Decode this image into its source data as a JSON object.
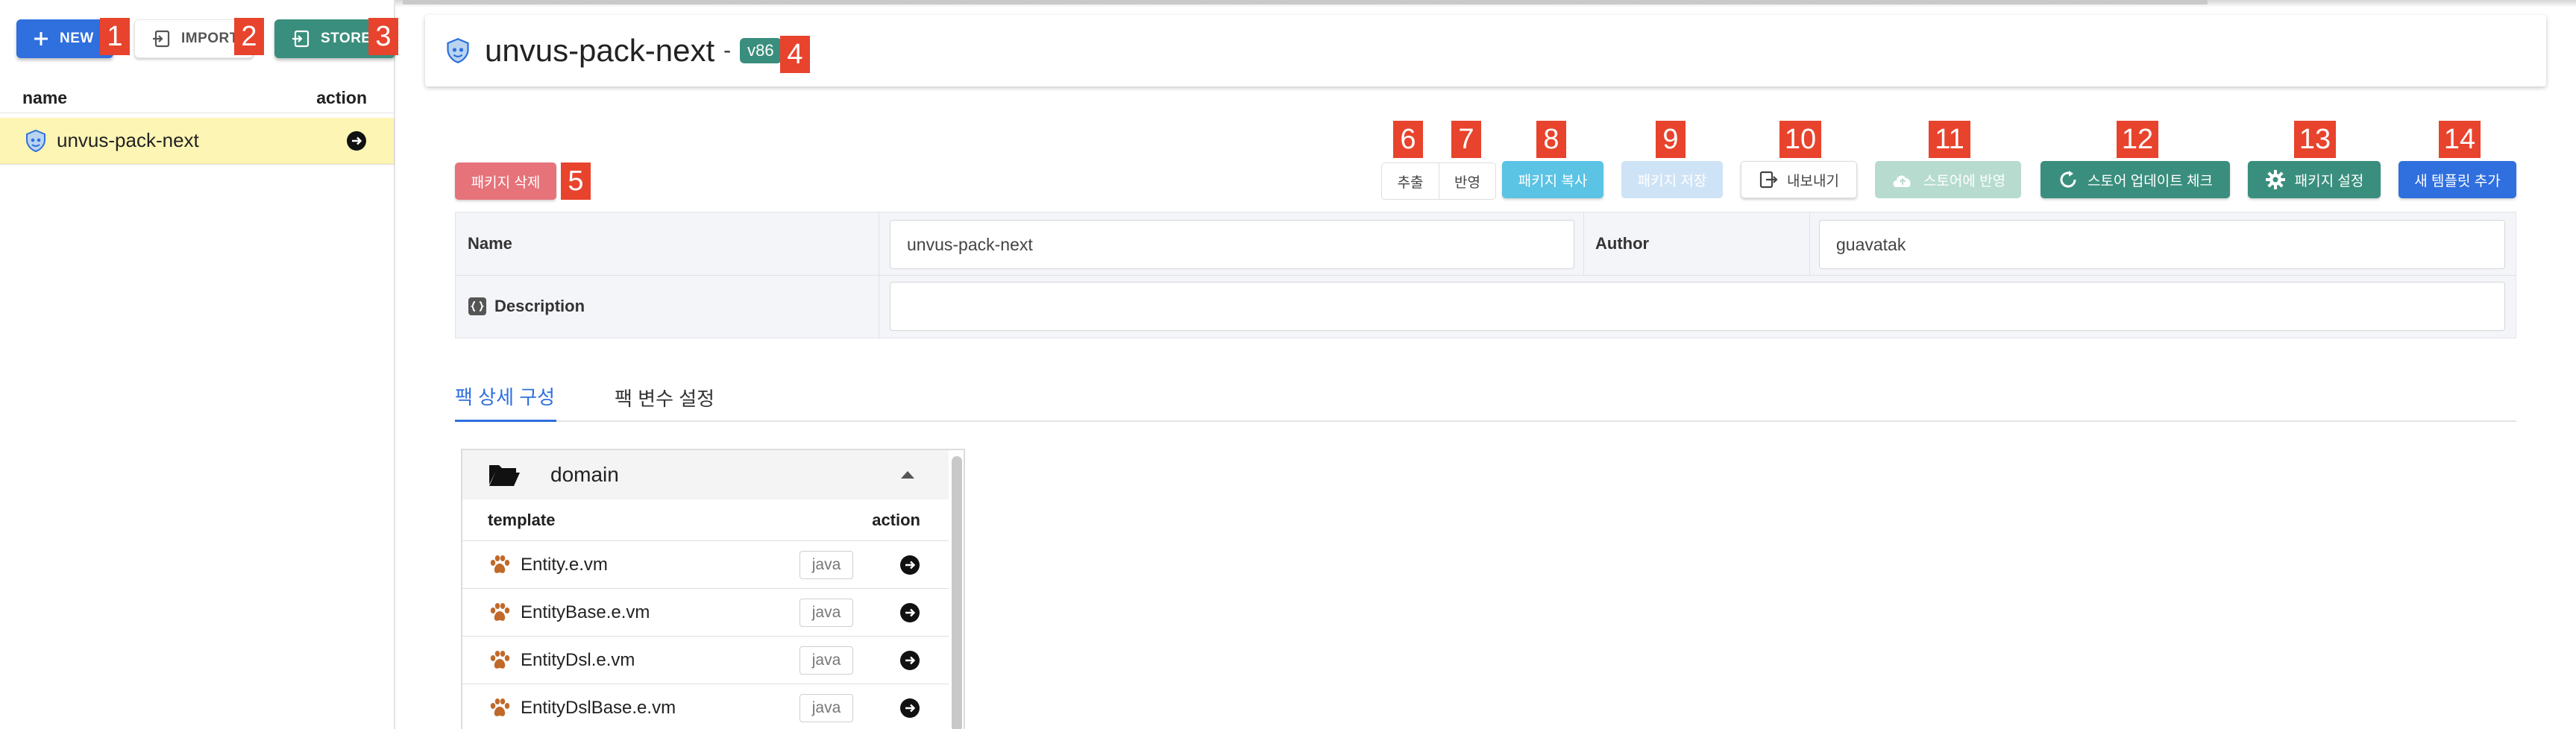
{
  "sidebar": {
    "new_label": "NEW",
    "import_label": "IMPORT",
    "store_label": "STORE",
    "col_name": "name",
    "col_action": "action",
    "items": [
      {
        "label": "unvus-pack-next"
      }
    ]
  },
  "header": {
    "title": "unvus-pack-next",
    "separator": "-",
    "version": "v86"
  },
  "actions": {
    "delete": "패키지 삭제",
    "extract": "추출",
    "apply": "반영",
    "copy": "패키지 복사",
    "save": "패키지 저장",
    "export": "내보내기",
    "store_apply": "스토어에 반영",
    "update_check": "스토어 업데이트 체크",
    "settings": "패키지 설정",
    "new_template": "새 템플릿 추가"
  },
  "info": {
    "name_label": "Name",
    "name_value": "unvus-pack-next",
    "author_label": "Author",
    "author_value": "guavatak",
    "description_label": "Description",
    "description_value": ""
  },
  "tabs": [
    {
      "label": "팩 상세 구성",
      "active": true
    },
    {
      "label": "팩 변수 설정",
      "active": false
    }
  ],
  "panel": {
    "folder": "domain",
    "col_template": "template",
    "col_action": "action",
    "rows": [
      {
        "name": "Entity.e.vm",
        "lang": "java"
      },
      {
        "name": "EntityBase.e.vm",
        "lang": "java"
      },
      {
        "name": "EntityDsl.e.vm",
        "lang": "java"
      },
      {
        "name": "EntityDslBase.e.vm",
        "lang": "java"
      }
    ]
  },
  "markers": [
    "1",
    "2",
    "3",
    "4",
    "5",
    "6",
    "7",
    "8",
    "9",
    "10",
    "11",
    "12",
    "13",
    "14"
  ],
  "colors": {
    "primary": "#2f6fde",
    "teal": "#3a8e7d",
    "danger": "#e6737a",
    "info": "#5bc3e4",
    "selected_row": "#fdf5b4",
    "marker": "#e8432d"
  }
}
